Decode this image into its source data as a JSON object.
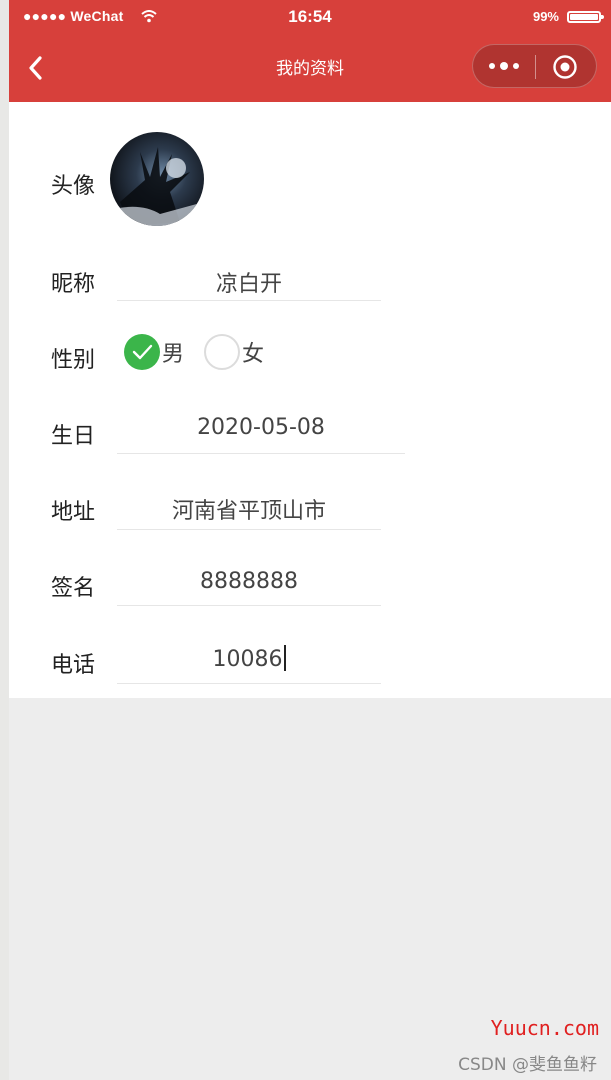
{
  "status_bar": {
    "carrier": "●●●●● WeChat",
    "time": "16:54",
    "battery": "99%"
  },
  "nav": {
    "title": "我的资料"
  },
  "profile": {
    "avatar_label": "头像",
    "nickname_label": "昵称",
    "nickname_value": "凉白开",
    "gender_label": "性别",
    "gender_options": [
      {
        "label": "男",
        "checked": true
      },
      {
        "label": "女",
        "checked": false
      }
    ],
    "birthday_label": "生日",
    "birthday_value": "2020-05-08",
    "address_label": "地址",
    "address_value": "河南省平顶山市",
    "signature_label": "签名",
    "signature_value": "8888888",
    "phone_label": "电话",
    "phone_value": "10086"
  },
  "watermarks": {
    "site": "Yuucn.com",
    "author": "CSDN @斐鱼鱼籽"
  },
  "colors": {
    "nav_bg": "#d7403b",
    "radio_checked": "#3bb54a",
    "page_bg": "#ededed"
  },
  "icons": [
    "back-arrow-icon",
    "more-dots-icon",
    "close-target-icon",
    "wifi-icon",
    "battery-icon",
    "checkmark-icon"
  ]
}
